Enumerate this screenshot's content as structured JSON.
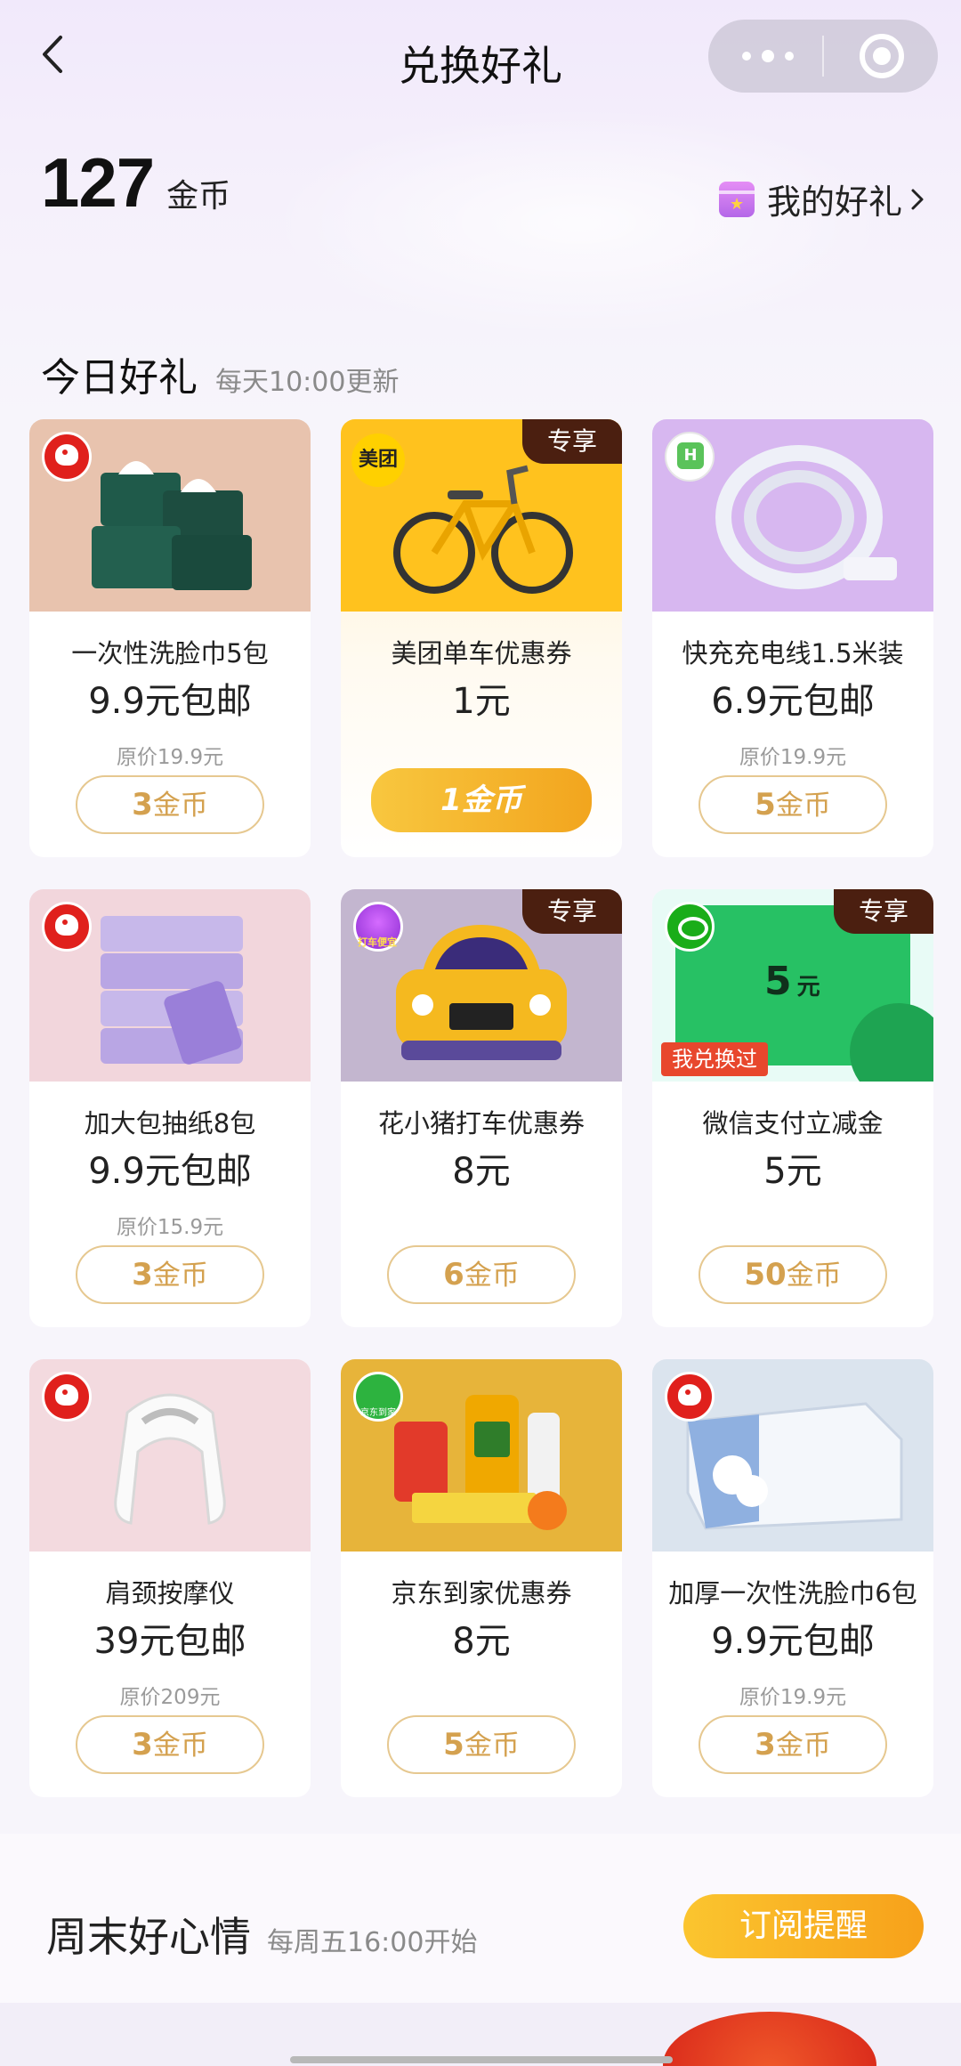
{
  "nav": {
    "title": "兑换好礼"
  },
  "header": {
    "coins": "127",
    "coin_unit": "金币",
    "my_gift": "我的好礼"
  },
  "today": {
    "title": "今日好礼",
    "subtitle": "每天10:00更新"
  },
  "cards": [
    {
      "name": "一次性洗脸巾5包",
      "price": "9.9元包邮",
      "orig": "原价19.9元",
      "cost_num": "3",
      "cost_unit": "金币",
      "img_bg": "#e8c3ae"
    },
    {
      "name": "美团单车优惠券",
      "price": "1元",
      "orig": "",
      "cost_num": "1",
      "cost_unit": "金币",
      "badge": "专享",
      "logo": "美团",
      "img_bg": "#ffc21e"
    },
    {
      "name": "快充充电线1.5米装",
      "price": "6.9元包邮",
      "orig": "原价19.9元",
      "cost_num": "5",
      "cost_unit": "金币",
      "logo": "H",
      "img_bg": "#d7b7f0"
    },
    {
      "name": "加大包抽纸8包",
      "price": "9.9元包邮",
      "orig": "原价15.9元",
      "cost_num": "3",
      "cost_unit": "金币",
      "img_bg": "#f2d6dc"
    },
    {
      "name": "花小猪打车优惠券",
      "price": "8元",
      "orig": "",
      "cost_num": "6",
      "cost_unit": "金币",
      "badge": "专享",
      "logo": "打车便宜",
      "img_bg": "#c3b6cf"
    },
    {
      "name": "微信支付立减金",
      "price": "5元",
      "orig": "",
      "cost_num": "50",
      "cost_unit": "金币",
      "badge": "专享",
      "done": "我兑换过",
      "voucher": "5",
      "voucher_unit": "元",
      "img_bg": "#e8fbf6"
    },
    {
      "name": "肩颈按摩仪",
      "price": "39元包邮",
      "orig": "原价209元",
      "cost_num": "3",
      "cost_unit": "金币",
      "img_bg": "#f3dadf"
    },
    {
      "name": "京东到家优惠券",
      "price": "8元",
      "orig": "",
      "cost_num": "5",
      "cost_unit": "金币",
      "logo": "京东到家",
      "img_bg": "#e7b43a"
    },
    {
      "name": "加厚一次性洗脸巾6包",
      "price": "9.9元包邮",
      "orig": "原价19.9元",
      "cost_num": "3",
      "cost_unit": "金币",
      "img_bg": "#dbe4ee"
    }
  ],
  "weekend": {
    "title": "周末好心情",
    "subtitle": "每周五16:00开始",
    "subscribe": "订阅提醒"
  },
  "colors": {
    "accent": "#f5b12a",
    "outline_btn_text": "#d4a14f",
    "badge_bg": "#4b1f10"
  },
  "icons": {
    "back": "chevron-left-icon",
    "more": "more-dots-icon",
    "close": "target-icon",
    "gift": "gift-box-icon"
  }
}
